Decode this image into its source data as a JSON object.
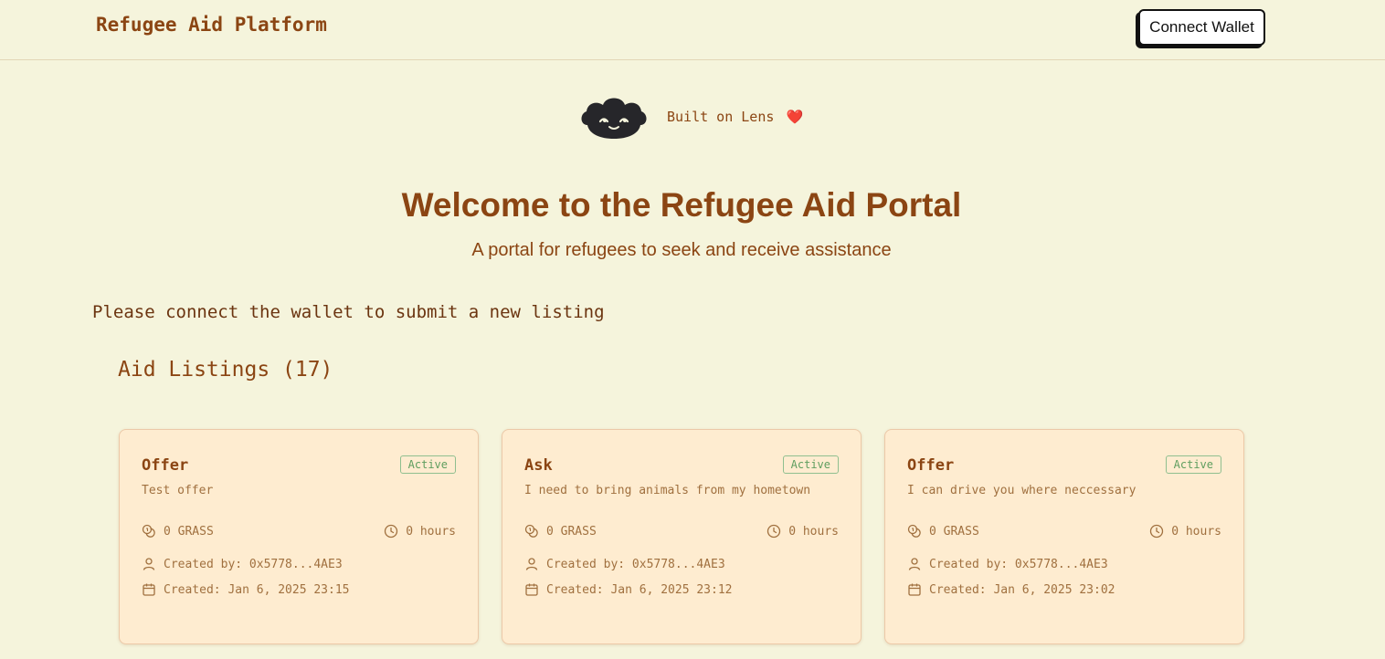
{
  "header": {
    "brand": "Refugee Aid Platform",
    "connect_wallet_label": "Connect Wallet"
  },
  "lens": {
    "text": "Built on Lens",
    "heart": "❤️"
  },
  "hero": {
    "title": "Welcome to the Refugee Aid Portal",
    "subtitle": "A portal for refugees to seek and receive assistance"
  },
  "connect_message": "Please connect the wallet to submit a new listing",
  "listings": {
    "title": "Aid Listings (17)",
    "items": [
      {
        "type": "Offer",
        "status": "Active",
        "description": "Test offer",
        "amount": "0 GRASS",
        "duration": "0 hours",
        "creator": "Created by: 0x5778...4AE3",
        "created": "Created: Jan 6, 2025 23:15"
      },
      {
        "type": "Ask",
        "status": "Active",
        "description": "I need to bring animals from my hometown",
        "amount": "0 GRASS",
        "duration": "0 hours",
        "creator": "Created by: 0x5778...4AE3",
        "created": "Created: Jan 6, 2025 23:12"
      },
      {
        "type": "Offer",
        "status": "Active",
        "description": "I can drive you where neccessary",
        "amount": "0 GRASS",
        "duration": "0 hours",
        "creator": "Created by: 0x5778...4AE3",
        "created": "Created: Jan 6, 2025 23:02"
      }
    ]
  },
  "icons": {
    "amount": "coins-icon",
    "duration": "clock-icon",
    "creator": "user-icon",
    "created": "calendar-icon",
    "logo": "lens-logo"
  },
  "colors": {
    "background": "#f5f4dc",
    "primary_text": "#8b4513",
    "card_background": "#feecd0",
    "badge_green": "#5f9e5f",
    "heart": "#e53935"
  }
}
